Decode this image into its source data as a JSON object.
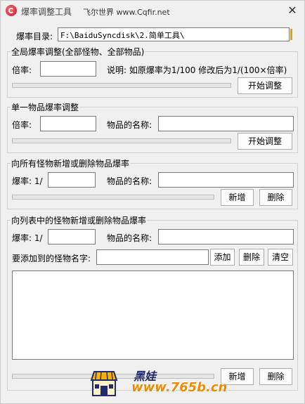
{
  "window": {
    "title": "爆率调整工具",
    "subtitle": "飞尔世界 www.Cqfir.net",
    "close_glyph": "✕"
  },
  "directory": {
    "label": "爆率目录:",
    "value": "F:\\BaiduSyncdisk\\2.简单工具\\"
  },
  "global_adjust": {
    "title": "全局爆率调整(全部怪物、全部物品)",
    "multiplier_label": "倍率:",
    "multiplier_value": "",
    "note": "说明: 如原爆率为1/100  修改后为1/(100×倍率)",
    "start_button": "开始调整"
  },
  "single_item": {
    "title": "单一物品爆率调整",
    "multiplier_label": "倍率:",
    "multiplier_value": "",
    "item_name_label": "物品的名称:",
    "item_name_value": "",
    "start_button": "开始调整"
  },
  "all_monsters": {
    "title": "向所有怪物新增或删除物品爆率",
    "rate_label": "爆率: 1/",
    "rate_value": "",
    "item_name_label": "物品的名称:",
    "item_name_value": "",
    "add_button": "新增",
    "delete_button": "删除"
  },
  "listed_monsters": {
    "title": "向列表中的怪物新增或删除物品爆率",
    "rate_label": "爆率: 1/",
    "rate_value": "",
    "item_name_label": "物品的名称:",
    "item_name_value": "",
    "monster_name_label": "要添加到的怪物名字:",
    "monster_name_value": "",
    "add_name_button": "添加",
    "delete_name_button": "删除",
    "clear_button": "清空",
    "monster_list": [],
    "add_button": "新增",
    "delete_button": "删除"
  },
  "watermark": {
    "brand": "黑娃",
    "url": "www.765b.cn",
    "icon": "shop-icon"
  },
  "colors": {
    "accent_red": "#c8102e",
    "watermark_orange": "#f08a00",
    "watermark_navy": "#1f2b6b"
  }
}
